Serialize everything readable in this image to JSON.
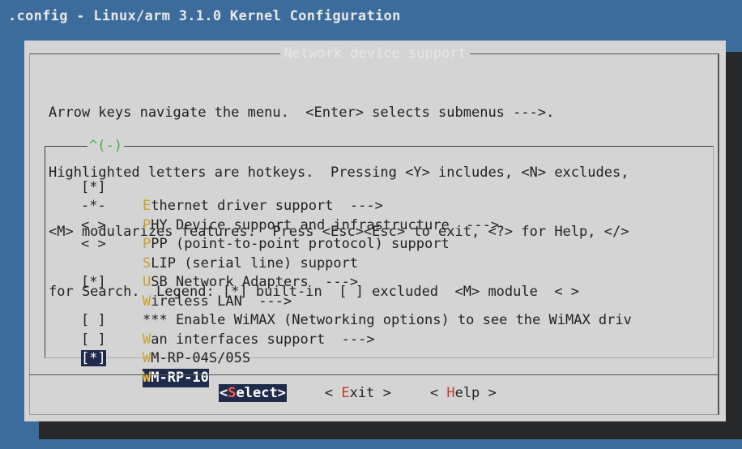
{
  "window": {
    "title": ".config - Linux/arm 3.1.0 Kernel Configuration"
  },
  "dialog": {
    "title": "Network device support",
    "help_lines": [
      "Arrow keys navigate the menu.  <Enter> selects submenus --->.",
      "Highlighted letters are hotkeys.  Pressing <Y> includes, <N> excludes,",
      "<M> modularizes features.  Press <Esc><Esc> to exit, <?> for Help, </>",
      "for Search.  Legend: [*] built-in  [ ] excluded  <M> module  < >"
    ],
    "scroll_indicator": "^(-)"
  },
  "menu": {
    "items": [
      {
        "mark": "[*]",
        "hotkey": "E",
        "rest": "thernet driver support  --->"
      },
      {
        "mark": "-*-",
        "hotkey": "P",
        "rest": "HY Device support and infrastructure  --->"
      },
      {
        "mark": "< >",
        "hotkey": "P",
        "rest": "PP (point-to-point protocol) support"
      },
      {
        "mark": "< >",
        "hotkey": "S",
        "rest": "LIP (serial line) support"
      },
      {
        "mark": "",
        "hotkey": "U",
        "rest": "SB Network Adapters  --->"
      },
      {
        "mark": "[*]",
        "hotkey": "W",
        "rest": "ireless LAN  --->"
      },
      {
        "mark": "",
        "hotkey": "",
        "rest": "*** Enable WiMAX (Networking options) to see the WiMAX driv"
      },
      {
        "mark": "[ ]",
        "hotkey": "W",
        "rest": "an interfaces support  --->"
      },
      {
        "mark": "[ ]",
        "hotkey": "W",
        "rest": "M-RP-04S/05S"
      },
      {
        "mark": "[*]",
        "hotkey": "W",
        "rest": "M-RP-10"
      }
    ],
    "selected_index": 9
  },
  "buttons": {
    "select": {
      "pre": "<",
      "hotkey": "S",
      "post": "elect>"
    },
    "exit": {
      "pre": "< ",
      "hotkey": "E",
      "post": "xit >"
    },
    "help": {
      "pre": "< ",
      "hotkey": "H",
      "post": "elp >"
    }
  },
  "colors": {
    "desktop": "#3b6c9c",
    "dialog": "#d4d4d4",
    "highlight": "#1e2b4a",
    "hotkey_item": "#c9a227",
    "hotkey_button": "#c53a2a",
    "scroll_indicator": "#43b04a"
  }
}
